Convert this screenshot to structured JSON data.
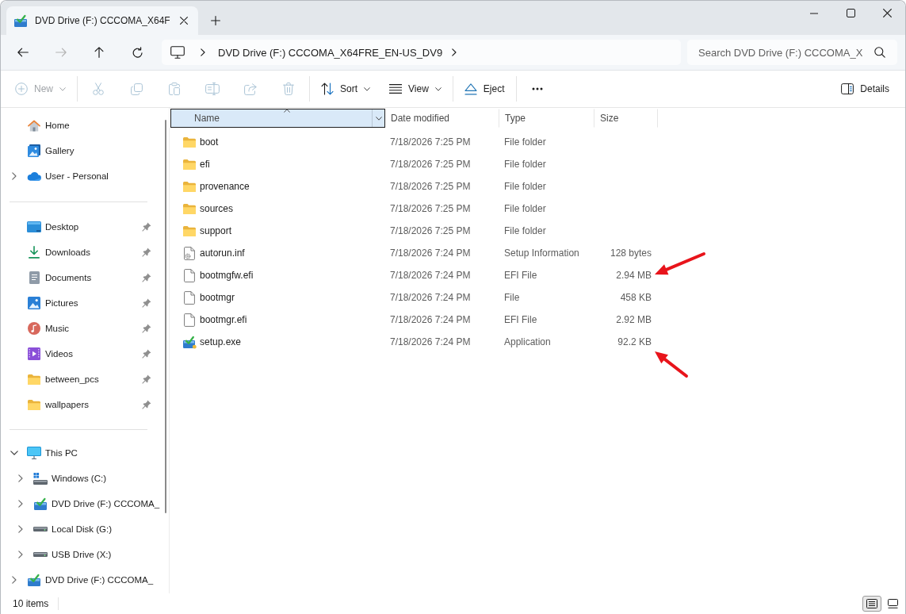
{
  "tabs": [
    {
      "title": "DVD Drive (F:) CCCOMA_X64F",
      "selected": true
    }
  ],
  "navigation": [
    {
      "kind": "back",
      "disabled": false
    },
    {
      "kind": "forward",
      "disabled": true
    },
    {
      "kind": "up",
      "disabled": false
    },
    {
      "kind": "refresh",
      "disabled": false
    }
  ],
  "address_bar": {
    "segments": [
      "DVD Drive (F:) CCCOMA_X64FRE_EN-US_DV9"
    ]
  },
  "search": {
    "placeholder": "Search DVD Drive (F:) CCCOMA_X"
  },
  "toolbar": {
    "groups": [
      {
        "items": [
          {
            "kind": "new",
            "label": "New",
            "disabled": true,
            "dropdown": true
          }
        ]
      },
      {
        "items": [
          {
            "kind": "cut",
            "disabled": true,
            "dropdown": false
          },
          {
            "kind": "copy",
            "disabled": true,
            "dropdown": false
          },
          {
            "kind": "paste",
            "disabled": true,
            "dropdown": false
          },
          {
            "kind": "rename",
            "disabled": true,
            "dropdown": false
          },
          {
            "kind": "share",
            "disabled": true,
            "dropdown": false
          },
          {
            "kind": "delete",
            "disabled": true,
            "dropdown": false
          }
        ]
      },
      {
        "items": [
          {
            "kind": "sort",
            "label": "Sort",
            "disabled": false,
            "dropdown": true
          },
          {
            "kind": "view",
            "label": "View",
            "disabled": false,
            "dropdown": true
          }
        ]
      },
      {
        "items": [
          {
            "kind": "eject",
            "label": "Eject",
            "disabled": false,
            "dropdown": false
          }
        ]
      },
      {
        "items": [
          {
            "kind": "more",
            "disabled": false,
            "dropdown": false
          }
        ]
      }
    ],
    "details_pane": {
      "label": "Details"
    }
  },
  "sidebar": {
    "sections": [
      {
        "items": [
          {
            "label": "Home",
            "kind": "home",
            "pinned": false
          },
          {
            "label": "Gallery",
            "kind": "gallery",
            "pinned": false
          },
          {
            "label": "User - Personal",
            "kind": "cloud",
            "expanded": false,
            "pinned": false
          }
        ]
      },
      {
        "items": [
          {
            "label": "Desktop",
            "kind": "desktop",
            "pinned": true
          },
          {
            "label": "Downloads",
            "kind": "downloads",
            "pinned": true
          },
          {
            "label": "Documents",
            "kind": "documents",
            "pinned": true
          },
          {
            "label": "Pictures",
            "kind": "pictures",
            "pinned": true
          },
          {
            "label": "Music",
            "kind": "music",
            "pinned": true
          },
          {
            "label": "Videos",
            "kind": "videos",
            "pinned": true
          },
          {
            "label": "between_pcs",
            "kind": "folder",
            "pinned": true
          },
          {
            "label": "wallpapers",
            "kind": "folder",
            "pinned": true
          }
        ]
      },
      {
        "items": [
          {
            "label": "This PC",
            "kind": "pc",
            "expanded": true,
            "pinned": false,
            "children": [
              {
                "label": "Windows (C:)",
                "kind": "system-drive",
                "expanded": false,
                "pinned": false
              },
              {
                "label": "DVD Drive (F:) CCCOMA_",
                "kind": "dvd-drive",
                "expanded": false,
                "pinned": false
              },
              {
                "label": "Local Disk (G:)",
                "kind": "drive",
                "expanded": false,
                "pinned": false
              },
              {
                "label": "USB Drive (X:)",
                "kind": "drive",
                "expanded": false,
                "pinned": false
              }
            ]
          },
          {
            "label": "DVD Drive (F:) CCCOMA_",
            "kind": "dvd-drive",
            "expanded": false,
            "pinned": false
          }
        ]
      }
    ]
  },
  "file_list": {
    "columns": [
      {
        "label": "Name",
        "sorted": true,
        "selected": true
      },
      {
        "label": "Date modified",
        "sorted": false,
        "selected": false
      },
      {
        "label": "Type",
        "sorted": false,
        "selected": false
      },
      {
        "label": "Size",
        "sorted": false,
        "selected": false
      }
    ],
    "rows": [
      {
        "kind": "folder",
        "name": "boot",
        "date_modified": "7/18/2026 7:25 PM",
        "type": "File folder",
        "selected": false,
        "arrow_from_upper_right": false,
        "arrow_from_lower_right": false
      },
      {
        "kind": "folder",
        "name": "efi",
        "date_modified": "7/18/2026 7:25 PM",
        "type": "File folder",
        "selected": false,
        "arrow_from_upper_right": false,
        "arrow_from_lower_right": false
      },
      {
        "kind": "folder",
        "name": "provenance",
        "date_modified": "7/18/2026 7:25 PM",
        "type": "File folder",
        "selected": false,
        "arrow_from_upper_right": false,
        "arrow_from_lower_right": false
      },
      {
        "kind": "folder",
        "name": "sources",
        "date_modified": "7/18/2026 7:25 PM",
        "type": "File folder",
        "selected": false,
        "arrow_from_upper_right": false,
        "arrow_from_lower_right": false
      },
      {
        "kind": "folder",
        "name": "support",
        "date_modified": "7/18/2026 7:25 PM",
        "type": "File folder",
        "selected": false,
        "arrow_from_upper_right": false,
        "arrow_from_lower_right": false
      },
      {
        "kind": "settings-file",
        "name": "autorun.inf",
        "date_modified": "7/18/2026 7:24 PM",
        "type": "Setup Information",
        "size": "128 bytes",
        "selected": false,
        "arrow_from_upper_right": false,
        "arrow_from_lower_right": false
      },
      {
        "kind": "file",
        "name": "bootmgfw.efi",
        "date_modified": "7/18/2026 7:24 PM",
        "type": "EFI File",
        "size": "2.94 MB",
        "selected": false,
        "arrow_from_upper_right": true,
        "arrow_from_lower_right": false
      },
      {
        "kind": "file",
        "name": "bootmgr",
        "date_modified": "7/18/2026 7:24 PM",
        "type": "File",
        "size": "458 KB",
        "selected": false,
        "arrow_from_upper_right": false,
        "arrow_from_lower_right": false
      },
      {
        "kind": "file",
        "name": "bootmgr.efi",
        "date_modified": "7/18/2026 7:24 PM",
        "type": "EFI File",
        "size": "2.92 MB",
        "selected": false,
        "arrow_from_upper_right": false,
        "arrow_from_lower_right": false
      },
      {
        "kind": "application",
        "name": "setup.exe",
        "date_modified": "7/18/2026 7:24 PM",
        "type": "Application",
        "size": "92.2 KB",
        "selected": false,
        "arrow_from_upper_right": false,
        "arrow_from_lower_right": true
      }
    ]
  },
  "status_bar": {
    "item_count": "10 items",
    "view_buttons": [
      {
        "kind": "details",
        "selected": true
      },
      {
        "kind": "tiles",
        "selected": false
      }
    ]
  }
}
